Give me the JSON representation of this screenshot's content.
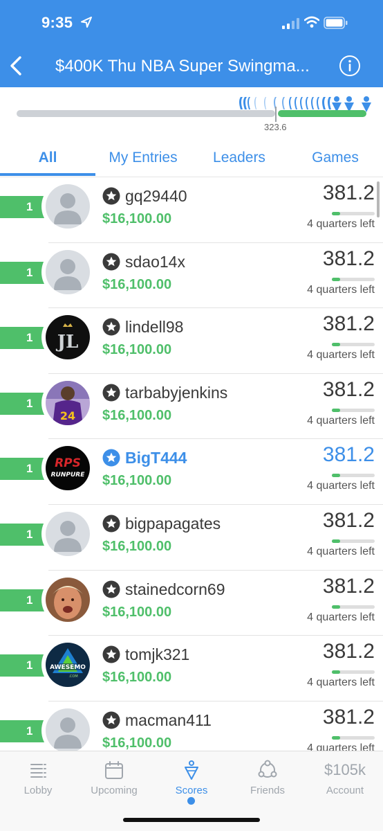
{
  "status_bar": {
    "time": "9:35"
  },
  "nav": {
    "title": "$400K Thu NBA Super Swingma..."
  },
  "progress": {
    "value_label": "323.6",
    "fraction": 0.75
  },
  "tabs": [
    {
      "label": "All",
      "active": true
    },
    {
      "label": "My Entries",
      "active": false
    },
    {
      "label": "Leaders",
      "active": false
    },
    {
      "label": "Games",
      "active": false
    }
  ],
  "entries": [
    {
      "rank": "1",
      "username": "gq29440",
      "winnings": "$16,100.00",
      "score": "381.2",
      "time_left": "4 quarters left",
      "avatar": "default-avatar",
      "is_me": false,
      "progress": 0.2
    },
    {
      "rank": "1",
      "username": "sdao14x",
      "winnings": "$16,100.00",
      "score": "381.2",
      "time_left": "4 quarters left",
      "avatar": "default-avatar",
      "is_me": false,
      "progress": 0.2
    },
    {
      "rank": "1",
      "username": "lindell98",
      "winnings": "$16,100.00",
      "score": "381.2",
      "time_left": "4 quarters left",
      "avatar": "jl-logo-avatar",
      "is_me": false,
      "progress": 0.2
    },
    {
      "rank": "1",
      "username": "tarbabyjenkins",
      "winnings": "$16,100.00",
      "score": "381.2",
      "time_left": "4 quarters left",
      "avatar": "jersey-24-avatar",
      "is_me": false,
      "progress": 0.2
    },
    {
      "rank": "1",
      "username": "BigT444",
      "winnings": "$16,100.00",
      "score": "381.2",
      "time_left": "4 quarters left",
      "avatar": "runpure-logo-avatar",
      "is_me": true,
      "progress": 0.2
    },
    {
      "rank": "1",
      "username": "bigpapagates",
      "winnings": "$16,100.00",
      "score": "381.2",
      "time_left": "4 quarters left",
      "avatar": "default-avatar",
      "is_me": false,
      "progress": 0.2
    },
    {
      "rank": "1",
      "username": "stainedcorn69",
      "winnings": "$16,100.00",
      "score": "381.2",
      "time_left": "4 quarters left",
      "avatar": "face-photo-avatar",
      "is_me": false,
      "progress": 0.2
    },
    {
      "rank": "1",
      "username": "tomjk321",
      "winnings": "$16,100.00",
      "score": "381.2",
      "time_left": "4 quarters left",
      "avatar": "awesemo-logo-avatar",
      "is_me": false,
      "progress": 0.2
    },
    {
      "rank": "1",
      "username": "macman411",
      "winnings": "$16,100.00",
      "score": "381.2",
      "time_left": "4 quarters left",
      "avatar": "default-avatar",
      "is_me": false,
      "progress": 0.2
    }
  ],
  "tabbar": [
    {
      "label": "Lobby",
      "icon": "list-icon",
      "active": false
    },
    {
      "label": "Upcoming",
      "icon": "calendar-icon",
      "active": false
    },
    {
      "label": "Scores",
      "icon": "scores-icon",
      "active": true
    },
    {
      "label": "Friends",
      "icon": "friends-icon",
      "active": false
    },
    {
      "label": "Account",
      "balance": "$105k",
      "active": false
    }
  ],
  "colors": {
    "brand_blue": "#3d8fe8",
    "money_green": "#4fbf6a"
  }
}
